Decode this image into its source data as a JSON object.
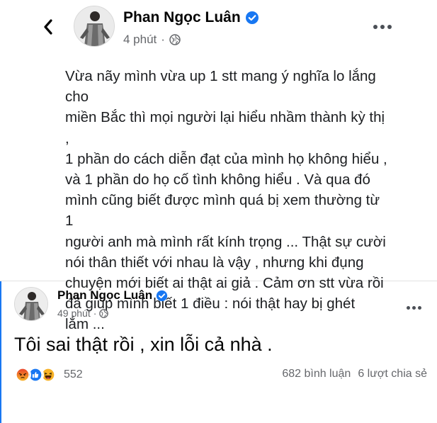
{
  "post1": {
    "author_name": "Phan Ngọc Luân",
    "time": "4 phút",
    "separator": "·",
    "text": "Vừa nãy mình vừa up 1 stt mang ý nghĩa lo lắng cho\nmiền Bắc thì mọi người lại hiểu nhầm thành kỳ thị ,\n1 phần do cách diễn đạt của mình họ không hiểu ,\nvà 1 phần do họ cố tình không hiểu . Và qua đó\nmình cũng biết được mình quá bị xem thường từ 1\nngười anh mà mình rất kính trọng ... Thật sự cười\nnói thân thiết với nhau là vậy , nhưng khi đụng\nchuyện mới biết ai thật ai giả . Cảm ơn stt vừa rồi\nđã giúp mình biết 1 điều : nói thật hay bị ghét\nlắm ...",
    "icons": [
      "back-arrow-icon",
      "verified-badge-icon",
      "globe-icon",
      "more-options-icon"
    ]
  },
  "post2": {
    "author_name": "Phan Ngọc Luân",
    "time": "49 phút",
    "separator": "·",
    "status": "Tôi sai thật rồi , xin lỗi cả nhà .",
    "reaction_count": "552",
    "comments": "682 bình luận",
    "shares": "6 lượt chia sẻ",
    "reactions": [
      "angry",
      "like",
      "haha"
    ]
  },
  "colors": {
    "verified_blue": "#1877f2",
    "meta_gray": "#65676b",
    "like_blue": "#1877f2",
    "angry_orange": "#f0582a",
    "haha_yellow": "#f7b125"
  }
}
